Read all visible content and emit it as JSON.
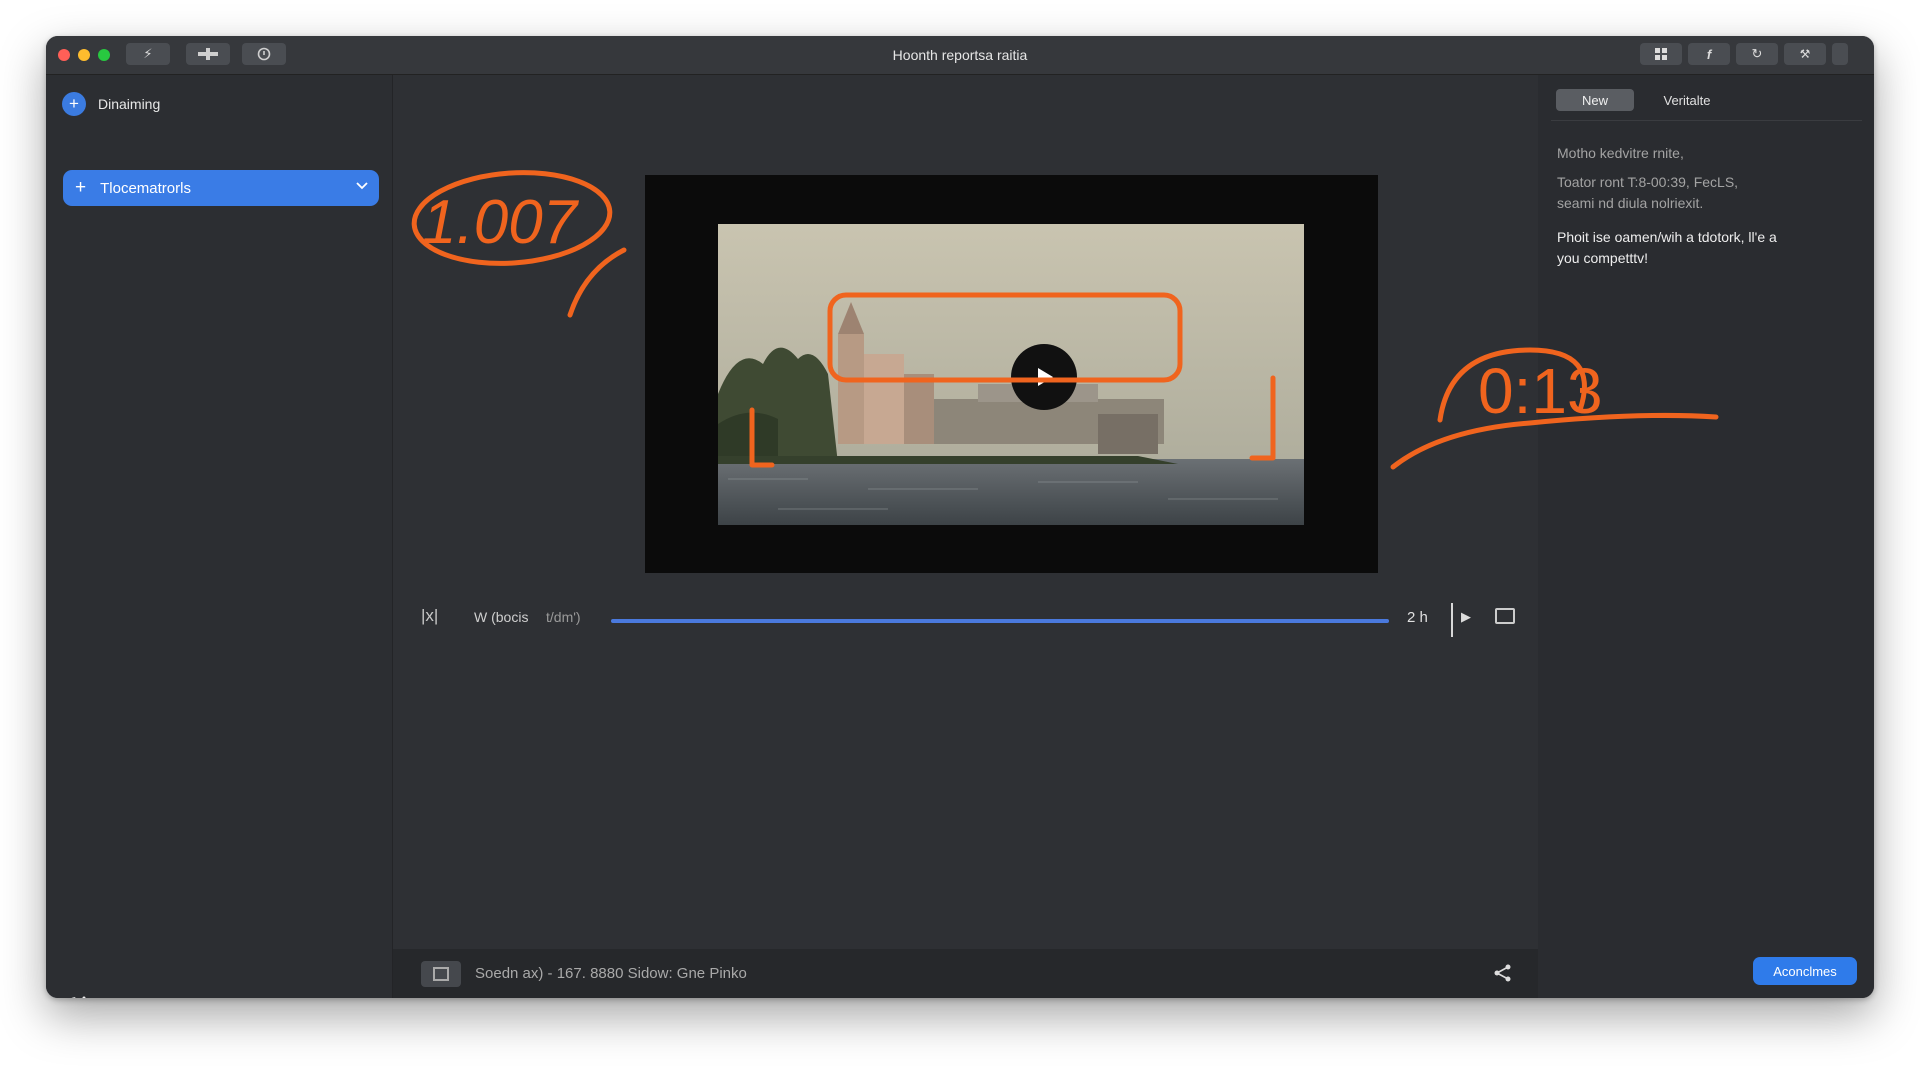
{
  "window": {
    "title": "Hoonth reportsa raitia",
    "toolbar_icons": [
      "bolt-icon",
      "command-icon",
      "help-circle-icon"
    ],
    "right_toolbar_icons": [
      "grid-icon",
      "function-icon",
      "sync-icon",
      "wrench-icon"
    ]
  },
  "sidebar": {
    "header_label": "Dinaiming",
    "active_item_label": "Tlocematrorls",
    "bottom_icon": "moon-icon"
  },
  "player": {
    "left_label": "W (bocis",
    "left_label_dim": "t/dm')",
    "progress": 1.0,
    "time_label": "2 h",
    "accent_color": "#4a79dd"
  },
  "annotations": {
    "left_number": "1.007",
    "right_number": "0:13",
    "stroke_color": "#f0641e"
  },
  "bottom_bar": {
    "status_text": "Soedn ax) - 167. 8880 Sidow: Gne Pinko"
  },
  "right_panel": {
    "tab_new": "New",
    "tab_other": "Veritalte",
    "line1": "Motho kedvitre rnite,",
    "line2": "Toator ront T:8-00:39, FecLS,",
    "line3": "seami nd diula nolriexit.",
    "line4": "Phoit ise oamen/wih a tdotork, ll'e a",
    "line5": "you competttv!",
    "action_label": "Aconclmes"
  }
}
